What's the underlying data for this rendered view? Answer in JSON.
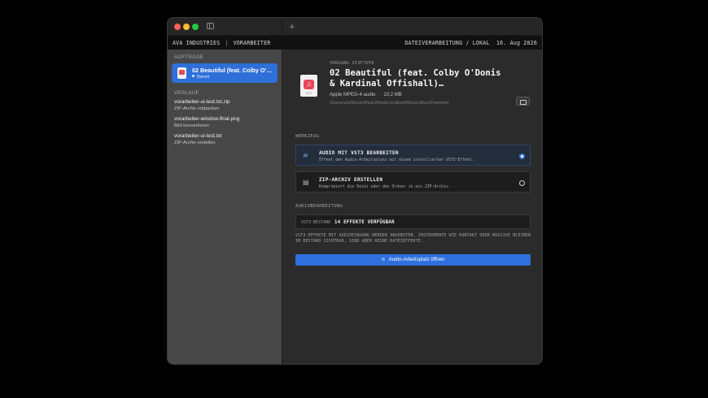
{
  "header": {
    "company": "AVA INDUSTRIES",
    "module": "VORARBEITER",
    "location": "DATEIVERARBEITUNG / LOKAL",
    "date": "16. Aug 2026"
  },
  "titlebar": {
    "new_tab_label": "+"
  },
  "sidebar": {
    "jobs_label": "AUFTRÄGE",
    "active_job": {
      "title": "02 Beautiful (feat. Colby O'D…",
      "status": "Bereit"
    },
    "history_label": "VERLAUF",
    "history": [
      {
        "title": "vorarbeiter-ui-test.txt.zip",
        "subtitle": "ZIP-Archiv entpacken"
      },
      {
        "title": "vorarbeiter-window-final.png",
        "subtitle": "Bild konvertieren"
      },
      {
        "title": "vorarbeiter-ui-test.txt",
        "subtitle": "ZIP-Archiv erstellen"
      }
    ]
  },
  "file": {
    "icon_ext": "MP3",
    "vorgang": "VORGANG 253F7D59",
    "title": "02 Beautiful (feat. Colby O'Donis & Kardinal Offishall)…",
    "kind": "Apple MPEG-4 audio",
    "size": "10,2 MB",
    "path": "/Users/ava/Music/Music/Media.localized/Music/Akon/Freedom/"
  },
  "tools": {
    "label": "WERKZEUG",
    "items": [
      {
        "title": "AUDIO MIT VST3 BEARBEITEN",
        "desc": "Öffnet den Audio-Arbeitsplatz mit einem installierten VST3-Effekt.",
        "icon": "waveform-icon",
        "selected": true
      },
      {
        "title": "ZIP-ARCHIV ERSTELLEN",
        "desc": "Komprimiert die Datei oder den Ordner in ein ZIP-Archiv.",
        "icon": "archive-icon",
        "selected": false
      }
    ]
  },
  "audio": {
    "label": "AUDIOBEARBEITUNG",
    "vst_label": "VST3-BESTAND",
    "vst_value": "14 EFFEKTE VERFÜGBAR",
    "note": "VST3-EFFEKTE MIT AUDIOEINGANG WERDEN ANGEBOTEN. INSTRUMENTE WIE KONTAKT ODER MASSIVE BLEIBEN IM BESTAND SICHTBAR, SIND ABER KEINE DATEIEFFEKTE.",
    "open_button": "Audio-Arbeitsplatz öffnen"
  },
  "colors": {
    "accent": "#2f6fde",
    "sidebar_bg": "#474747",
    "main_bg": "#2b2b2b"
  }
}
